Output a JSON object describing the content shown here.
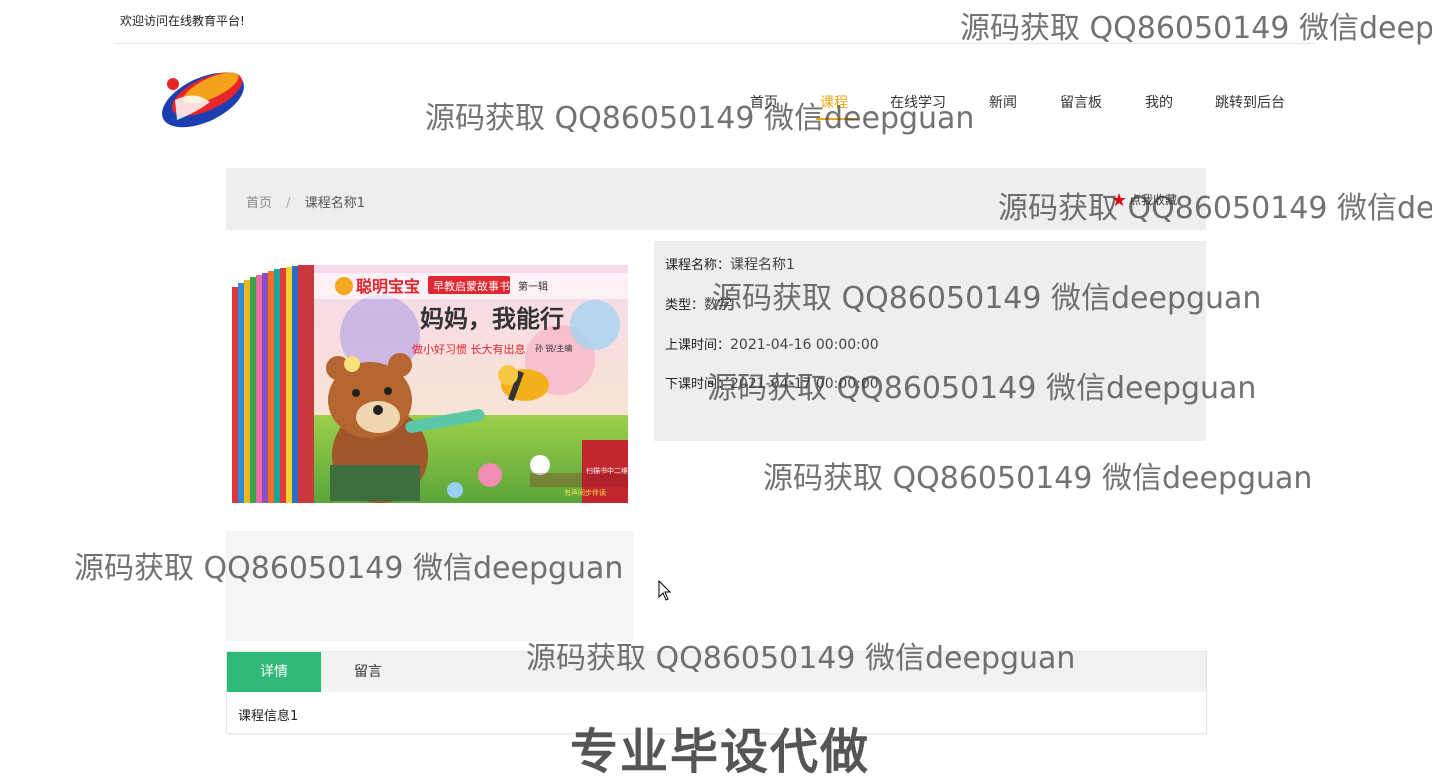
{
  "topbar": {
    "welcome": "欢迎访问在线教育平台!"
  },
  "nav": [
    {
      "label": "首页"
    },
    {
      "label": "课程",
      "active": true
    },
    {
      "label": "在线学习"
    },
    {
      "label": "新闻"
    },
    {
      "label": "留言板"
    },
    {
      "label": "我的"
    },
    {
      "label": "跳转到后台"
    }
  ],
  "breadcrumb": {
    "home": "首页",
    "separator": "/",
    "current": "课程名称1",
    "favorite": "点我收藏"
  },
  "course": {
    "name_label": "课程名称：",
    "name": "课程名称1",
    "type_label": "类型：",
    "type": "数学",
    "start_label": "上课时间：",
    "start": "2021-04-16 00:00:00",
    "end_label": "下课时间：",
    "end": "2021-04-17 00:00:00"
  },
  "book": {
    "brand": "聪明宝宝",
    "series": "早教启蒙故事书",
    "volume": "第一辑",
    "title": "妈妈，我能行",
    "author": "孙 锐/主编",
    "tagline": "做小好习惯 长大有出息",
    "qr_note": "扫描书中二维码",
    "audio_note": "有声同步伴读"
  },
  "tabs": [
    {
      "label": "详情",
      "active": true
    },
    {
      "label": "留言"
    }
  ],
  "tab_content": "课程信息1",
  "watermark": "源码获取 QQ86050149 微信deepguan",
  "watermark_big": "专业毕设代做",
  "colors": {
    "accent": "#e5a70f",
    "tab_active": "#2fb877",
    "star": "#e60012"
  }
}
